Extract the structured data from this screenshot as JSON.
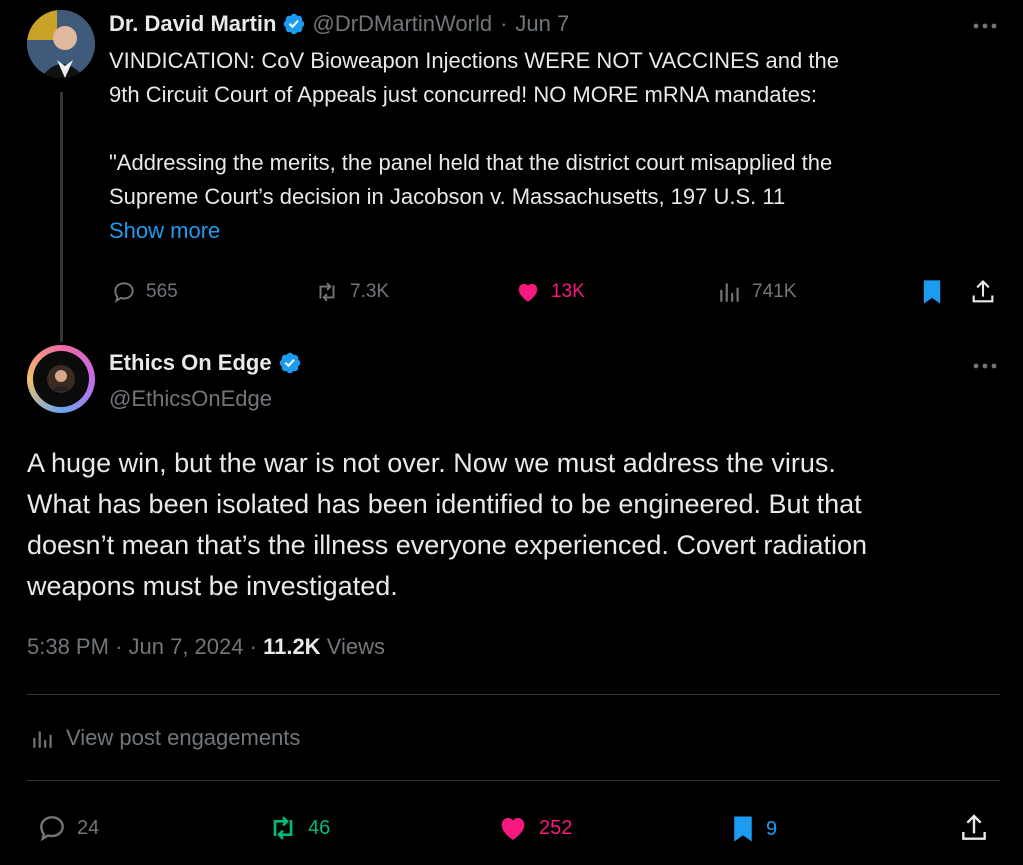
{
  "parent": {
    "name": "Dr. David Martin",
    "handle": "@DrDMartinWorld",
    "sep": "·",
    "date": "Jun 7",
    "line1": "VINDICATION: CoV Bioweapon Injections WERE NOT VACCINES and the",
    "line2": "9th Circuit Court of Appeals just concurred!  NO MORE mRNA mandates:",
    "line3": "\"Addressing the merits, the panel held that the district court misapplied the",
    "line4": "Supreme Court’s decision in Jacobson v. Massachusetts, 197 U.S. 11",
    "show_more": "Show more",
    "replies": "565",
    "reposts": "7.3K",
    "likes": "13K",
    "views": "741K"
  },
  "post": {
    "name": "Ethics On Edge",
    "handle": "@EthicsOnEdge",
    "line1": "A huge win, but the war is not over. Now we must address the virus.",
    "line2": "What has been isolated has been identified to be engineered. But that",
    "line3": "doesn’t mean that’s the illness everyone experienced. Covert radiation",
    "line4": "weapons must be investigated.",
    "time": "5:38 PM",
    "dot": "·",
    "date": "Jun 7, 2024",
    "views_count": "11.2K",
    "views_label": "Views",
    "engagements_label": "View post engagements",
    "replies": "24",
    "reposts": "46",
    "likes": "252",
    "bookmarks": "9"
  },
  "colors": {
    "background": "#000000",
    "text": "#e7e9ea",
    "muted": "#71767b",
    "link": "#1d9bf0",
    "like": "#f91880",
    "repost": "#00ba7c",
    "bookmark": "#1d9bf0"
  },
  "icons": [
    "verified-badge-icon",
    "more-icon",
    "reply-icon",
    "repost-icon",
    "like-icon",
    "views-icon",
    "bookmark-icon",
    "share-icon",
    "analytics-icon"
  ]
}
